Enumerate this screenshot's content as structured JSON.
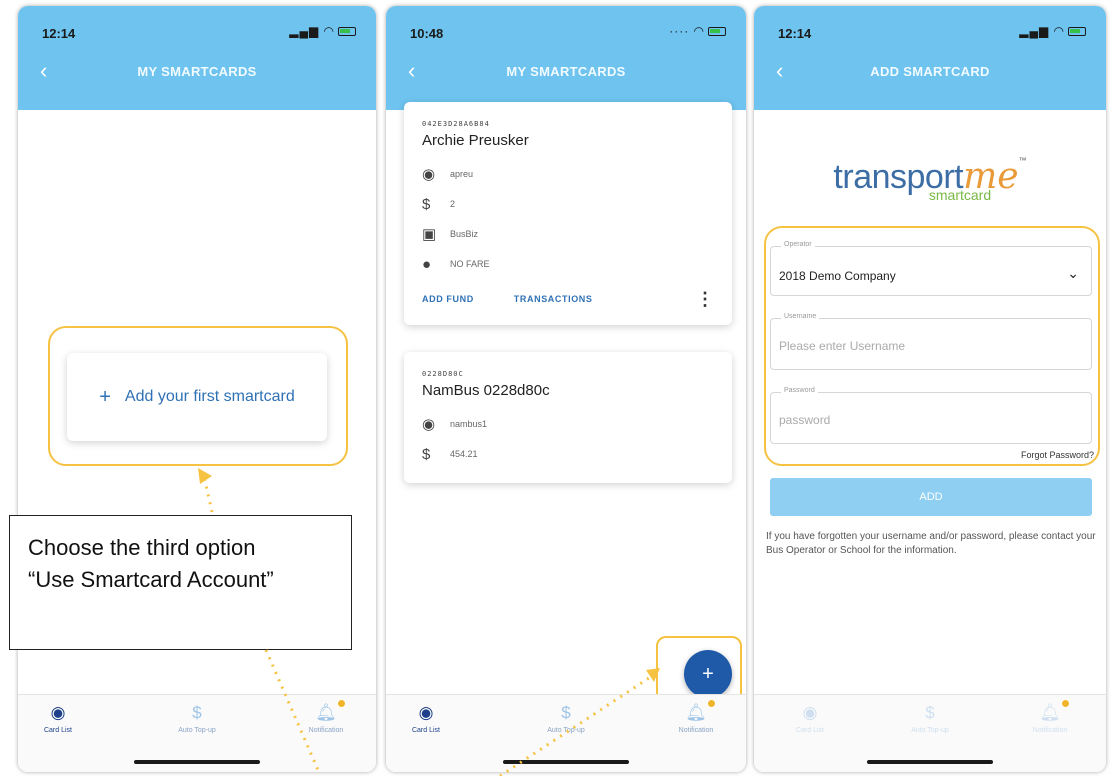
{
  "colors": {
    "header": "#6ec3ef",
    "callout": "#f5c242",
    "primary": "#2f71b5",
    "fab": "#1e5aa8"
  },
  "phone1": {
    "time": "12:14",
    "title": "MY SMARTCARDS",
    "back_icon": "chevron-left-icon",
    "add_first_card": "Add your first smartcard",
    "tabs": [
      "Card List",
      "Auto Top-up",
      "Notification"
    ]
  },
  "note": {
    "line1": "Choose the third option",
    "line2": "“Use Smartcard Account”"
  },
  "phone2": {
    "time": "10:48",
    "title": "MY SMARTCARDS",
    "cards": [
      {
        "id": "042E3D28A6B84",
        "name": "Archie Preusker",
        "user": "apreu",
        "balance": "2",
        "operator": "BusBiz",
        "fare": "NO FARE",
        "add_fund": "ADD FUND",
        "transactions": "TRANSACTIONS"
      },
      {
        "id": "0228D80C",
        "name": "NamBus 0228d80c",
        "user": "nambus1",
        "balance": "454.21"
      }
    ],
    "fab_label": "+",
    "tabs": [
      "Card List",
      "Auto Top-up",
      "Notification"
    ]
  },
  "phone3": {
    "time": "12:14",
    "title": "ADD SMARTCARD",
    "logo": {
      "main": "transport",
      "accent": "me",
      "tm": "™",
      "sub": "smartcard"
    },
    "operator_label": "Operator",
    "operator_value": "2018 Demo Company",
    "username_label": "Username",
    "username_placeholder": "Please enter Username",
    "password_label": "Password",
    "password_placeholder": "password",
    "forgot": "Forgot Password?",
    "add_button": "ADD",
    "help": "If you have forgotten your username and/or password, please contact your Bus Operator or School for the information.",
    "tabs": [
      "Card List",
      "Auto Top-up",
      "Notification"
    ]
  }
}
